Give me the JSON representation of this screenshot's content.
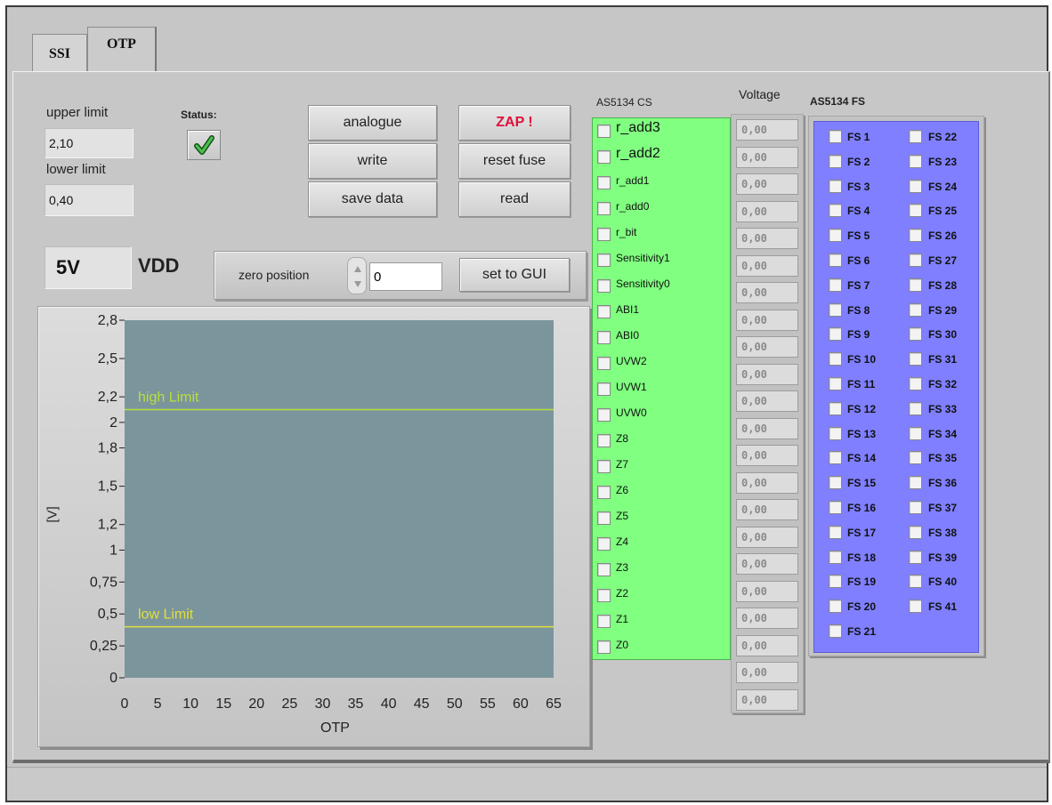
{
  "tabs": [
    "SSI",
    "OTP"
  ],
  "limits": {
    "upper_label": "upper limit",
    "upper_value": "2,10",
    "lower_label": "lower limit",
    "lower_value": "0,40"
  },
  "status": {
    "label": "Status:",
    "state": "ok",
    "icon": "checkmark-icon",
    "color": "#2e8b2e"
  },
  "buttons": {
    "analogue": "analogue",
    "write": "write",
    "save_data": "save data",
    "zap": "ZAP !",
    "reset_fuse": "reset fuse",
    "read": "read",
    "set_to_gui": "set to GUI"
  },
  "vdd": {
    "value": "5V",
    "label": "VDD"
  },
  "zero_position": {
    "label": "zero position",
    "value": "0"
  },
  "chart_data": {
    "type": "line",
    "xlabel": "OTP",
    "ylabel": "[V]",
    "xlim": [
      0,
      65
    ],
    "ylim": [
      0,
      2.8
    ],
    "x_ticks": [
      "0",
      "5",
      "10",
      "15",
      "20",
      "25",
      "30",
      "35",
      "40",
      "45",
      "50",
      "55",
      "60",
      "65"
    ],
    "y_ticks": [
      {
        "v": 2.8,
        "t": "2,8"
      },
      {
        "v": 2.5,
        "t": "2,5"
      },
      {
        "v": 2.2,
        "t": "2,2"
      },
      {
        "v": 2.0,
        "t": "2"
      },
      {
        "v": 1.8,
        "t": "1,8"
      },
      {
        "v": 1.5,
        "t": "1,5"
      },
      {
        "v": 1.2,
        "t": "1,2"
      },
      {
        "v": 1.0,
        "t": "1"
      },
      {
        "v": 0.75,
        "t": "0,75"
      },
      {
        "v": 0.5,
        "t": "0,5"
      },
      {
        "v": 0.25,
        "t": "0,25"
      },
      {
        "v": 0,
        "t": "0"
      }
    ],
    "lines": [
      {
        "name": "high Limit",
        "y": 2.1,
        "color": "#b8e03a"
      },
      {
        "name": "low Limit",
        "y": 0.4,
        "color": "#e0e03a"
      }
    ],
    "plot_bg": "#7b959c"
  },
  "cs": {
    "title": "AS5134 CS",
    "color": "#80ff80",
    "items": [
      "r_add3",
      "r_add2",
      "r_add1",
      "r_add0",
      "r_bit",
      "Sensitivity1",
      "Sensitivity0",
      "ABI1",
      "ABI0",
      "UVW2",
      "UVW1",
      "UVW0",
      "Z8",
      "Z7",
      "Z6",
      "Z5",
      "Z4",
      "Z3",
      "Z2",
      "Z1",
      "Z0"
    ]
  },
  "voltage": {
    "title": "Voltage",
    "values": [
      "0,00",
      "0,00",
      "0,00",
      "0,00",
      "0,00",
      "0,00",
      "0,00",
      "0,00",
      "0,00",
      "0,00",
      "0,00",
      "0,00",
      "0,00",
      "0,00",
      "0,00",
      "0,00",
      "0,00",
      "0,00",
      "0,00",
      "0,00",
      "0,00",
      "0,00"
    ]
  },
  "fs": {
    "title": "AS5134 FS",
    "color": "#7f7fff",
    "col1": [
      "FS 1",
      "FS 2",
      "FS 3",
      "FS 4",
      "FS 5",
      "FS 6",
      "FS 7",
      "FS 8",
      "FS 9",
      "FS 10",
      "FS 11",
      "FS 12",
      "FS 13",
      "FS 14",
      "FS 15",
      "FS 16",
      "FS 17",
      "FS 18",
      "FS 19",
      "FS 20",
      "FS 21"
    ],
    "col2": [
      "FS 22",
      "FS 23",
      "FS 24",
      "FS 25",
      "FS 26",
      "FS 27",
      "FS 28",
      "FS 29",
      "FS 30",
      "FS 31",
      "FS 32",
      "FS 33",
      "FS 34",
      "FS 35",
      "FS 36",
      "FS 37",
      "FS 38",
      "FS 39",
      "FS 40",
      "FS 41"
    ]
  }
}
